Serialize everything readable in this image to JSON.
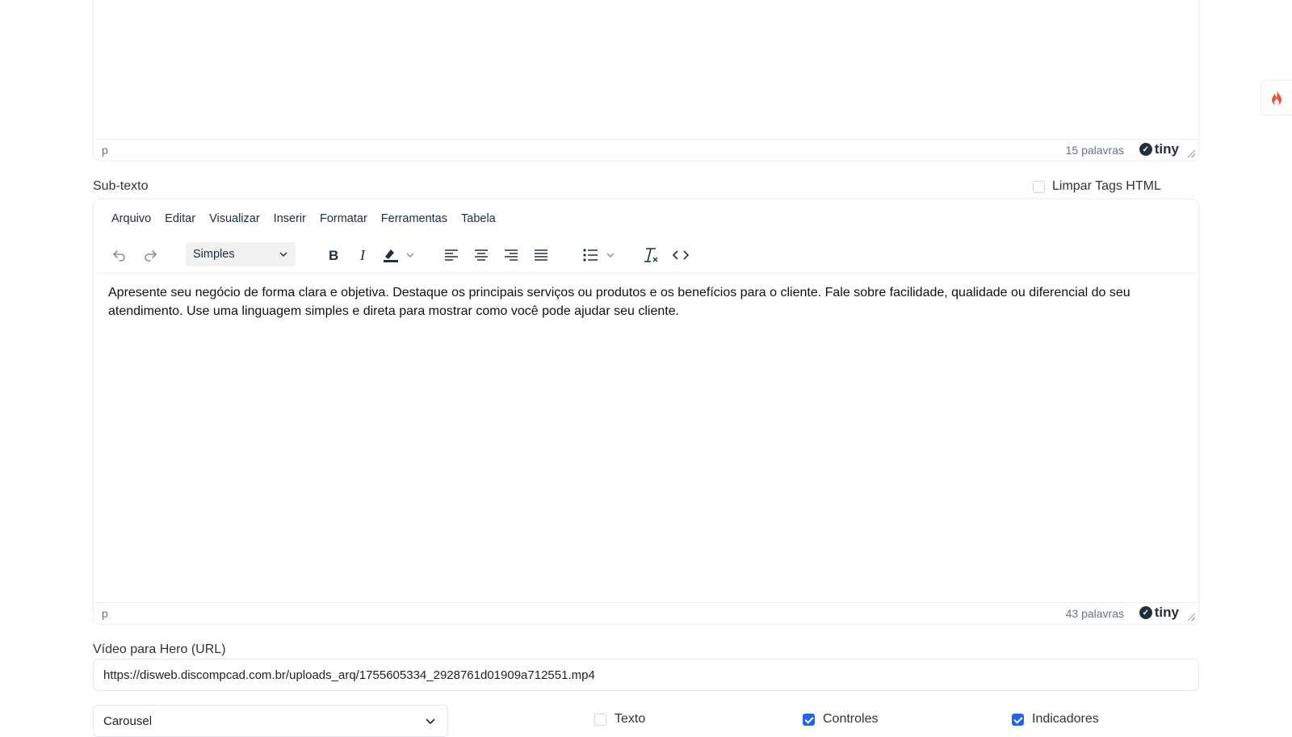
{
  "editor_top": {
    "status_path": "p",
    "word_count": "15 palavras",
    "brand": "tiny"
  },
  "subtexto": {
    "label": "Sub-texto",
    "clear_html_label": "Limpar Tags HTML",
    "clear_html_checked": false,
    "menu": [
      "Arquivo",
      "Editar",
      "Visualizar",
      "Inserir",
      "Formatar",
      "Ferramentas",
      "Tabela"
    ],
    "format_select": "Simples",
    "toolbar_icons": [
      "undo-icon",
      "redo-icon",
      "bold-icon",
      "italic-icon",
      "highlight-color-icon",
      "align-left-icon",
      "align-center-icon",
      "align-right-icon",
      "align-justify-icon",
      "bullet-list-icon",
      "clear-formatting-icon",
      "source-code-icon"
    ],
    "content": "Apresente seu negócio de forma clara e objetiva. Destaque os principais serviços ou produtos e os benefícios para o cliente. Fale sobre facilidade, qualidade ou diferencial do seu atendimento. Use uma linguagem simples e direta para mostrar como você pode ajudar seu cliente.",
    "status_path": "p",
    "word_count": "43 palavras",
    "brand": "tiny"
  },
  "video": {
    "label": "Vídeo para Hero (URL)",
    "value": "https://disweb.discompcad.com.br/uploads_arq/1755605334_2928761d01909a712551.mp4"
  },
  "hero_type": {
    "selected": "Carousel"
  },
  "options": [
    {
      "label": "Texto",
      "checked": false
    },
    {
      "label": "Controles",
      "checked": true
    },
    {
      "label": "Indicadores",
      "checked": true
    }
  ],
  "colors": {
    "accent": "#2563eb",
    "flame": "#e8553a"
  },
  "side_icon": "flame-icon"
}
